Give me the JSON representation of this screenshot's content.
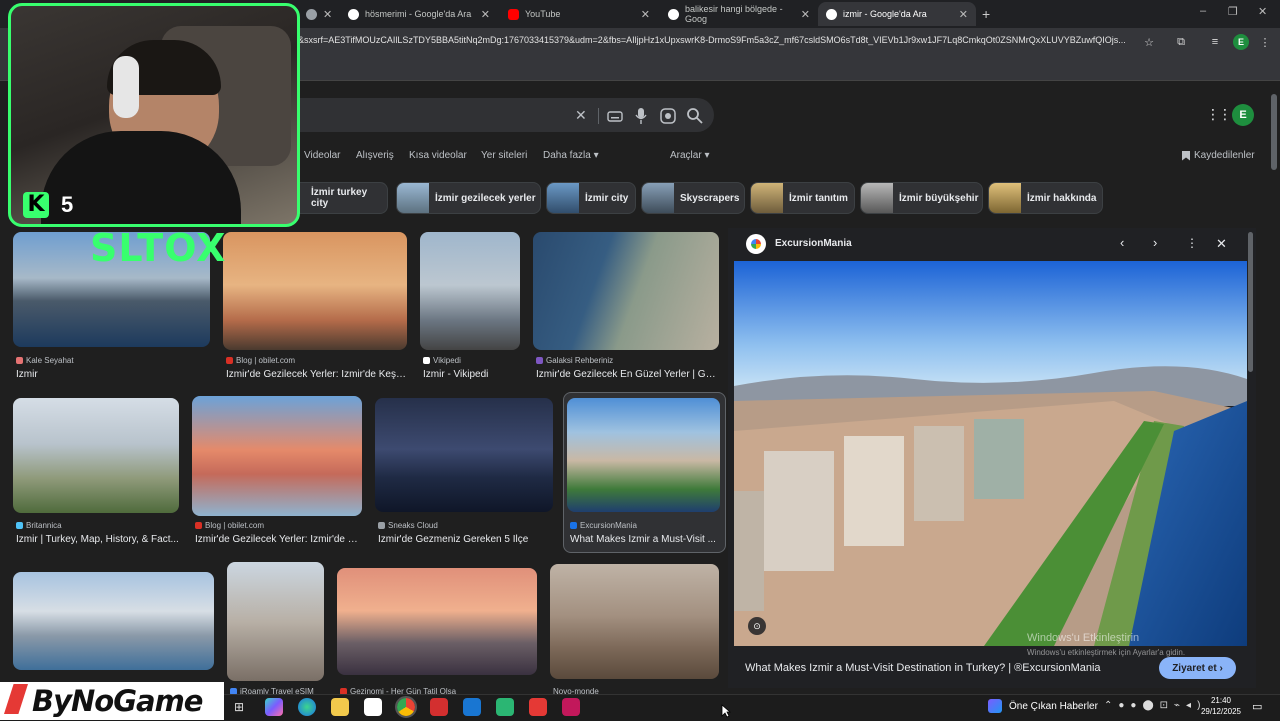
{
  "browser": {
    "tabs": [
      {
        "title": "",
        "favicon_color": "#9aa0a6"
      },
      {
        "title": "hösmerimi - Google'da Ara",
        "favicon_color": "#ffffff"
      },
      {
        "title": "YouTube",
        "favicon_color": "#ff0000"
      },
      {
        "title": "balikesir hangi bölgede - Goog",
        "favicon_color": "#ffffff"
      },
      {
        "title": "izmir - Google'da Ara",
        "favicon_color": "#ffffff",
        "active": true
      }
    ],
    "new_tab": "+",
    "url": "&sxsrf=AE3TifMOUzCAIlLSzTDY5BBA5titNq2mDg:1767033415379&udm=2&fbs=AIljpHz1xUpxswrK8-DrmoS9Fm5a3cZ_mf67csldSMO6sTd8t_VIEVb1Jr9xw1JF7Lq8CmkqOt0ZSNMrQxXLUVYBZuwfQIOjs...",
    "profile_initial": "E"
  },
  "google": {
    "search_clear": "✕",
    "apps_icon": "⋮⋮",
    "profile_initial": "E",
    "nav_tabs": [
      "Videolar",
      "Alışveriş",
      "Kısa videolar",
      "Yer siteleri",
      "Daha fazla ▾"
    ],
    "tools": "Araçlar ▾",
    "saved": "Kaydedilenler",
    "chips": [
      {
        "label": "İzmir turkey city",
        "color": "#6a8fb0"
      },
      {
        "label": "İzmir gezilecek yerler",
        "color": "#8aa6c4"
      },
      {
        "label": "İzmir city",
        "color": "#5d86b3"
      },
      {
        "label": "Skyscrapers",
        "color": "#7d95ad"
      },
      {
        "label": "İzmir tanıtım",
        "color": "#b69c62"
      },
      {
        "label": "İzmir büyükşehir",
        "color": "#8c8c8c"
      },
      {
        "label": "İzmir hakkında",
        "color": "#c4a45c"
      }
    ],
    "results": [
      {
        "source": "Kale Seyahat",
        "title": "İzmir"
      },
      {
        "source": "Blog | obilet.com",
        "title": "İzmir'de Gezilecek Yerler: İzmir'de Keşf..."
      },
      {
        "source": "Vikipedi",
        "title": "İzmir - Vikipedi"
      },
      {
        "source": "Galaksi Rehberiniz",
        "title": "İzmir'de Gezilecek En Güzel Yerler | Gal..."
      },
      {
        "source": "Britannica",
        "title": "İzmir | Turkey, Map, History, & Fact..."
      },
      {
        "source": "Blog | obilet.com",
        "title": "İzmir'de Gezilecek Yerler: İzmir'de K..."
      },
      {
        "source": "Sneaks Cloud",
        "title": "İzmir'de Gezmeniz Gereken 5 İlçe"
      },
      {
        "source": "ExcursionMania",
        "title": "What Makes Izmir a Must-Visit ..."
      },
      {
        "source": "",
        "title": ""
      },
      {
        "source": "iRoamly Travel eSIM",
        "title": ""
      },
      {
        "source": "Gezinomi - Her Gün Tatil Olsa",
        "title": ""
      },
      {
        "source": "Novo-monde",
        "title": ""
      }
    ],
    "preview": {
      "site": "ExcursionMania",
      "caption": "What Makes Izmir a Must-Visit Destination in Turkey? | ®ExcursionMania",
      "visit": "Ziyaret et ›",
      "watermark_line1": "Windows'u Etkinleştirin",
      "watermark_line2": "Windows'u etkinleştirmek için Ayarlar'a gidin."
    }
  },
  "overlay": {
    "streamer": "SLTOX",
    "level": "5",
    "brand": "ByNoGame"
  },
  "taskbar": {
    "news": "Öne Çıkan Haberler",
    "time": "21:40",
    "date": "29/12/2025"
  }
}
